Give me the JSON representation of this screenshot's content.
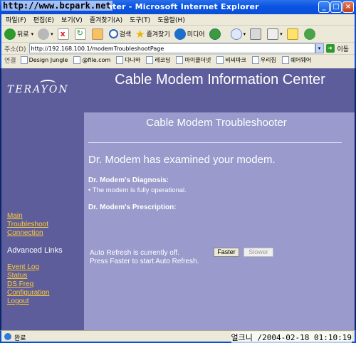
{
  "window": {
    "title": "nter - Microsoft Internet Explorer",
    "watermark": "http://www.bcpark.net"
  },
  "menu": [
    "파일(F)",
    "편집(E)",
    "보기(V)",
    "즐겨찾기(A)",
    "도구(T)",
    "도움말(H)"
  ],
  "toolbar": {
    "back": "뒤로",
    "search": "검색",
    "favorites": "즐겨찾기",
    "media": "미디어"
  },
  "address": {
    "label": "주소(D)",
    "value": "http://192.168.100.1/modemTroubleshootPage",
    "go": "이동"
  },
  "links": {
    "label": "연결",
    "items": [
      "Design Jungle",
      "@file.com",
      "다나와",
      "레코딩",
      "마이클더넷",
      "비씨파크",
      "우리집",
      "쉐어웨어"
    ]
  },
  "header": {
    "logo": "TERAYON",
    "title": "Cable Modem Information Center"
  },
  "sidebar": {
    "main": "Main",
    "troubleshoot": "Troubleshoot",
    "connection": "Connection",
    "advanced_heading": "Advanced Links",
    "event_log": "Event Log",
    "status": "Status",
    "ds_freq": "DS Freq",
    "configuration": "Configuration",
    "logout": "Logout"
  },
  "content": {
    "subtitle": "Cable Modem Troubleshooter",
    "examined": "Dr. Modem has examined your modem.",
    "diagnosis_heading": "Dr. Modem's Diagnosis:",
    "diagnosis_item": "• The modem is fully operational.",
    "prescription_heading": "Dr. Modem's Prescription:",
    "refresh_line1": "Auto Refresh is currently off.",
    "refresh_line2": "Press Faster to start Auto Refresh.",
    "faster_label": "Faster",
    "slower_label": "Slower"
  },
  "statusbar": {
    "text": "완료",
    "timestamp": "2004-02-18 01:10:19",
    "timestamp_prefix": "얼크니 /"
  },
  "colors": {
    "header_bg": "#5d5d9b",
    "content_bg": "#9a9acc",
    "link_color": "#ffcc33"
  }
}
